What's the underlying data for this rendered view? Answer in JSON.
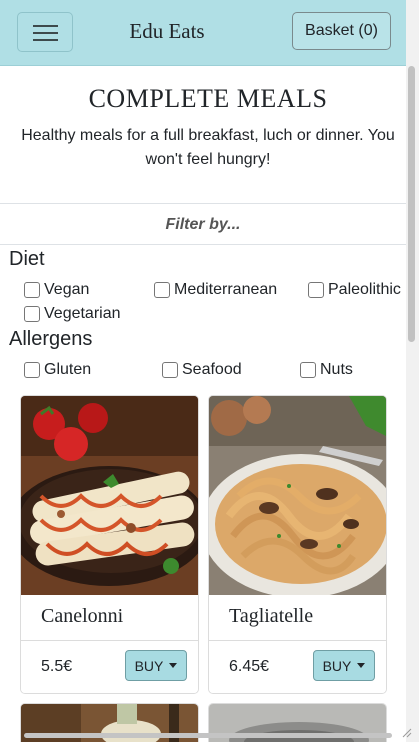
{
  "navbar": {
    "brand": "Edu Eats",
    "basket_label": "Basket (0)"
  },
  "hero": {
    "title": "COMPLETE MEALS",
    "description": "Healthy meals for a full breakfast, luch or dinner. You won't feel hungry!"
  },
  "filter": {
    "title": "Filter by...",
    "diet_title": "Diet",
    "diet_options": [
      "Vegan",
      "Mediterranean",
      "Paleolithic",
      "Vegetarian"
    ],
    "allergens_title": "Allergens",
    "allergen_options": [
      "Gluten",
      "Seafood",
      "Nuts"
    ]
  },
  "products": [
    {
      "name": "Canelonni",
      "price": "5.5€",
      "buy_label": "BUY"
    },
    {
      "name": "Tagliatelle",
      "price": "6.45€",
      "buy_label": "BUY"
    }
  ],
  "colors": {
    "navbar_bg": "#b0dfe5",
    "buy_bg": "#a8dbe2"
  }
}
